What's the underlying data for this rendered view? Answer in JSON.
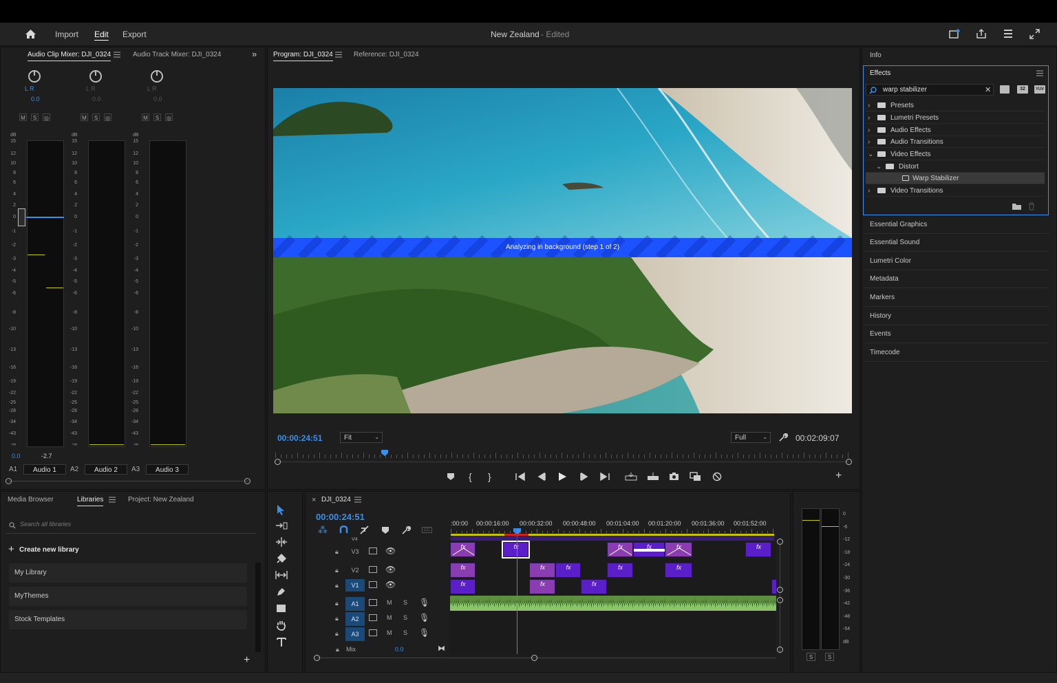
{
  "header": {
    "nav": {
      "import": "Import",
      "edit": "Edit",
      "export": "Export"
    },
    "project_title": "New Zealand",
    "status": "- Edited"
  },
  "mixer": {
    "tabs": [
      "Audio Clip Mixer: DJI_0324",
      "Audio Track Mixer: DJI_0324"
    ],
    "channels": [
      {
        "pan_lr": "L R",
        "pan_value": "0.0",
        "track": "A1",
        "name": "Audio 1",
        "level_l": "0.0",
        "level_r": "-2.7"
      },
      {
        "pan_lr": "L R",
        "pan_value": "0.0",
        "track": "A2",
        "name": "Audio 2"
      },
      {
        "pan_lr": "L R",
        "pan_value": "0.0",
        "track": "A3",
        "name": "Audio 3"
      }
    ],
    "msr": [
      "M",
      "S",
      "◎"
    ],
    "db_label": "dB",
    "scale": [
      "15",
      "12",
      "10",
      "8",
      "6",
      "4",
      "2",
      "0",
      "-1",
      "-2",
      "-3",
      "-4",
      "-5",
      "-6",
      "-8",
      "-10",
      "-13",
      "-16",
      "-19",
      "-22",
      "-25",
      "-28",
      "-34",
      "-43",
      "-∞"
    ]
  },
  "program": {
    "tabs": [
      "Program: DJI_0324",
      "Reference: DJI_0324"
    ],
    "banner": "Analyzing in background (step 1 of 2)",
    "timecode_current": "00:00:24:51",
    "fit": "Fit",
    "quality": "Full",
    "timecode_duration": "00:02:09:07",
    "playhead_fraction": 0.19
  },
  "panels": {
    "info": "Info",
    "effects": {
      "title": "Effects",
      "search_value": "warp stabilizer",
      "badges": [
        "32",
        "YUV"
      ],
      "tree": [
        {
          "label": "Presets",
          "level": 0
        },
        {
          "label": "Lumetri Presets",
          "level": 0
        },
        {
          "label": "Audio Effects",
          "level": 0
        },
        {
          "label": "Audio Transitions",
          "level": 0
        },
        {
          "label": "Video Effects",
          "level": 0
        },
        {
          "label": "Distort",
          "level": 1
        },
        {
          "label": "Warp Stabilizer",
          "level": 2
        },
        {
          "label": "Video Transitions",
          "level": 0
        }
      ]
    },
    "side": [
      "Essential Graphics",
      "Essential Sound",
      "Lumetri Color",
      "Metadata",
      "Markers",
      "History",
      "Events",
      "Timecode"
    ]
  },
  "libraries": {
    "tabs": [
      "Media Browser",
      "Libraries",
      "Project: New Zealand"
    ],
    "search_placeholder": "Search all libraries",
    "create": "Create new library",
    "items": [
      "My Library",
      "MyThemes",
      "Stock Templates"
    ]
  },
  "timeline": {
    "sequence": "DJI_0324",
    "timecode": "00:00:24:51",
    "ruler": [
      ":00:00",
      "00:00:16:00",
      "00:00:32:00",
      "00:00:48:00",
      "00:01:04:00",
      "00:01:20:00",
      "00:01:36:00",
      "00:01:52:00"
    ],
    "tracks": {
      "v4": "V4",
      "v3": "V3",
      "v2": "V2",
      "v1": "V1",
      "a1": "A1",
      "a2": "A2",
      "a3": "A3",
      "mix": "Mix",
      "mix_value": "0.0"
    },
    "ms": [
      "M",
      "S"
    ],
    "fx": "fx"
  },
  "audio_meter": {
    "scale": [
      "0",
      "-6",
      "-12",
      "-18",
      "-24",
      "-30",
      "-36",
      "-42",
      "-48",
      "-54",
      "dB"
    ],
    "solo": [
      "S",
      "S"
    ]
  },
  "colors": {
    "accent": "#3b8fe8",
    "clip_purple": "#8a3db0",
    "clip_violet": "#5a1fc8",
    "audio_green": "#6aa84f"
  }
}
